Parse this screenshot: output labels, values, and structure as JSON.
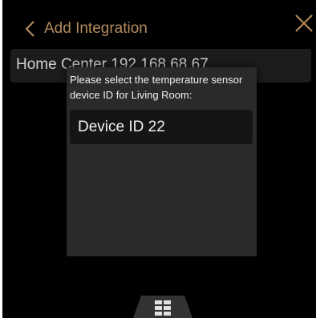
{
  "header": {
    "back_icon": "chevron-left-icon",
    "title": "Add Integration",
    "close_icon": "close-icon"
  },
  "list": {
    "items": [
      {
        "label": "Home Center 192.168.68.67"
      }
    ]
  },
  "dialog": {
    "prompt": "Please select the temperature sensor device ID for Living Room:",
    "options": [
      {
        "label": "Device ID 22"
      }
    ]
  },
  "bottom_bar": {
    "menu_icon": "grid-menu-icon"
  },
  "colors": {
    "accent": "#b38a5c",
    "background": "#000000",
    "dialog": "#2a2a2a"
  }
}
